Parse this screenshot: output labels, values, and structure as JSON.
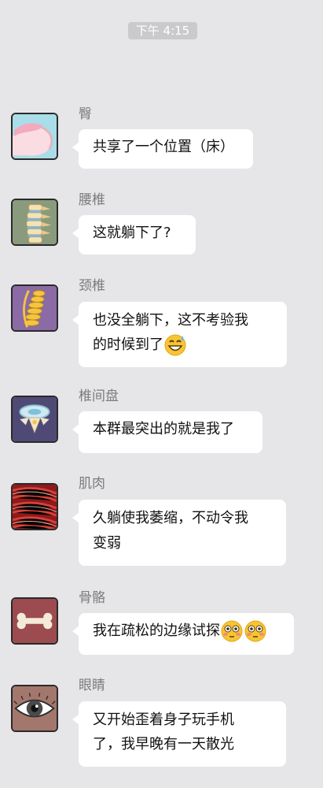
{
  "status": {
    "time": "下午 4:15"
  },
  "messages": [
    {
      "sender": "臀",
      "text": "共享了一个位置（床）",
      "avatar_icon": "buttocks-avatar-icon"
    },
    {
      "sender": "腰椎",
      "text": "这就躺下了?",
      "avatar_icon": "lumbar-spine-avatar-icon"
    },
    {
      "sender": "颈椎",
      "text_line1": "也没全躺下，这不考验我",
      "text_line2": "的时候到了",
      "emoji": "sweat-smile-emoji-icon",
      "avatar_icon": "cervical-spine-avatar-icon"
    },
    {
      "sender": "椎间盘",
      "text": "本群最突出的就是我了",
      "avatar_icon": "intervertebral-disc-avatar-icon"
    },
    {
      "sender": "肌肉",
      "text_line1": "久躺使我萎缩，不动令我",
      "text_line2": "变弱",
      "avatar_icon": "muscle-avatar-icon"
    },
    {
      "sender": "骨骼",
      "text": "我在疏松的边缘试探",
      "emoji": "flushed-face-emoji-icon",
      "avatar_icon": "bone-avatar-icon"
    },
    {
      "sender": "眼睛",
      "text_line1": "又开始歪着身子玩手机",
      "text_line2": "了，我早晚有一天散光",
      "avatar_icon": "eye-avatar-icon"
    }
  ]
}
